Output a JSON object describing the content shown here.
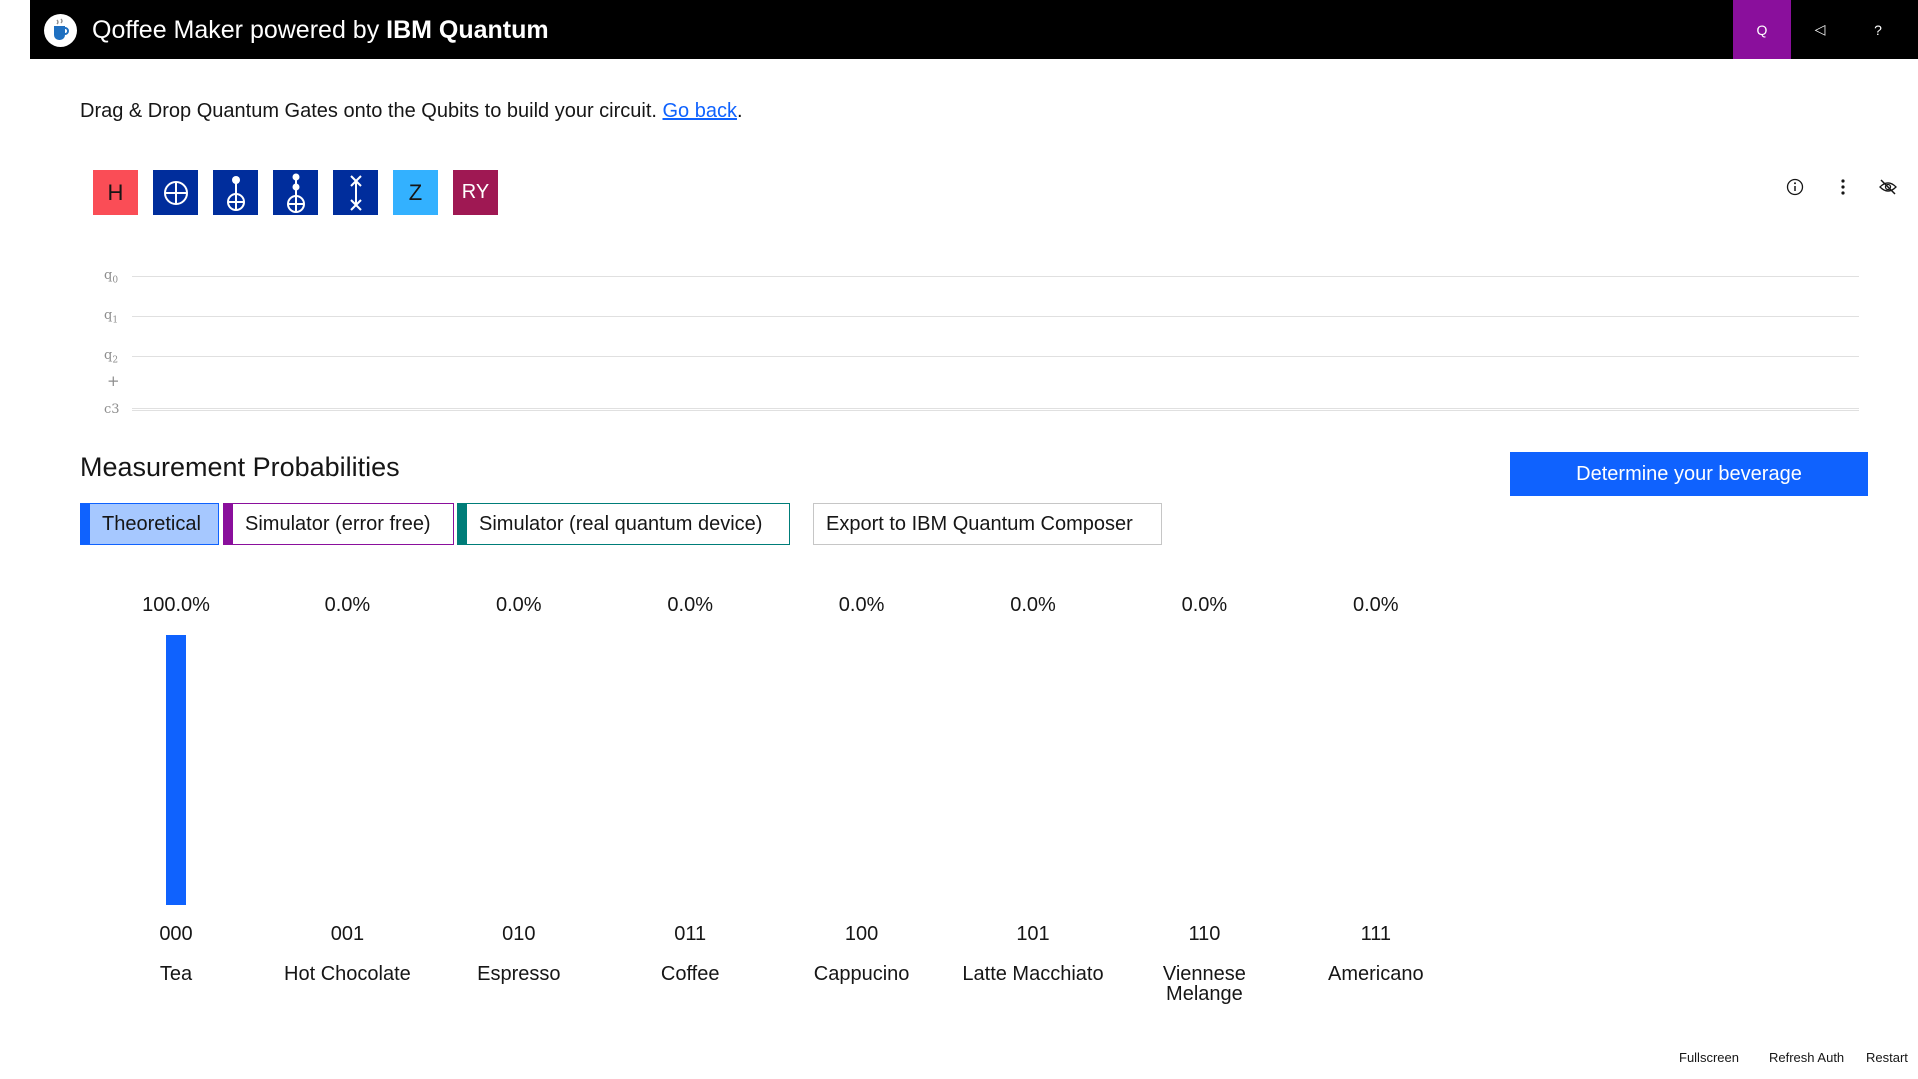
{
  "header": {
    "title_prefix": "Qoffee Maker powered by ",
    "title_brand": "IBM Quantum",
    "buttons": [
      {
        "label": "Q",
        "icon": "quantum-q-icon",
        "active": true
      },
      {
        "label": "◁",
        "icon": "back-triangle-icon",
        "active": false
      },
      {
        "label": "?",
        "icon": "help-icon",
        "active": false
      }
    ],
    "active_color": "#8a0f9c"
  },
  "intro": {
    "text": "Drag & Drop Quantum Gates onto the Qubits to build your circuit. ",
    "link": "Go back",
    "suffix": "."
  },
  "gates": [
    {
      "label": "H",
      "type": "hadamard",
      "color": "#fa4d56"
    },
    {
      "label": "",
      "type": "not",
      "color": "#002d9c"
    },
    {
      "label": "",
      "type": "cnot",
      "color": "#002d9c"
    },
    {
      "label": "",
      "type": "toffoli",
      "color": "#002d9c"
    },
    {
      "label": "",
      "type": "swap",
      "color": "#002d9c"
    },
    {
      "label": "Z",
      "type": "z",
      "color": "#33b1ff"
    },
    {
      "label": "RY",
      "type": "ry",
      "color": "#9f1853"
    }
  ],
  "toolbar_icons": [
    "info-icon",
    "overflow-menu-icon",
    "hide-icon"
  ],
  "circuit": {
    "qubits": [
      {
        "name": "q",
        "index": "0"
      },
      {
        "name": "q",
        "index": "1"
      },
      {
        "name": "q",
        "index": "2"
      }
    ],
    "add_symbol": "+",
    "classical": "c3"
  },
  "measurement": {
    "title": "Measurement Probabilities",
    "determine_button": "Determine your beverage",
    "tabs": [
      {
        "label": "Theoretical",
        "color": "#0f62fe",
        "selected": true
      },
      {
        "label": "Simulator (error free)",
        "color": "#8a0f9c",
        "selected": false
      },
      {
        "label": "Simulator (real quantum device)",
        "color": "#007d79",
        "selected": false
      }
    ],
    "export_button": "Export to IBM Quantum Composer"
  },
  "chart_data": {
    "type": "bar",
    "categories": [
      "000",
      "001",
      "010",
      "011",
      "100",
      "101",
      "110",
      "111"
    ],
    "beverages": [
      "Tea",
      "Hot Chocolate",
      "Espresso",
      "Coffee",
      "Cappucino",
      "Latte Macchiato",
      "Viennese Melange",
      "Americano"
    ],
    "values": [
      100.0,
      0.0,
      0.0,
      0.0,
      0.0,
      0.0,
      0.0,
      0.0
    ],
    "value_labels": [
      "100.0%",
      "0.0%",
      "0.0%",
      "0.0%",
      "0.0%",
      "0.0%",
      "0.0%",
      "0.0%"
    ],
    "ylim": [
      0,
      100
    ],
    "bar_color": "#0f62fe",
    "grid": false
  },
  "footer": {
    "links": [
      "Fullscreen",
      "Refresh Auth",
      "Restart"
    ]
  }
}
